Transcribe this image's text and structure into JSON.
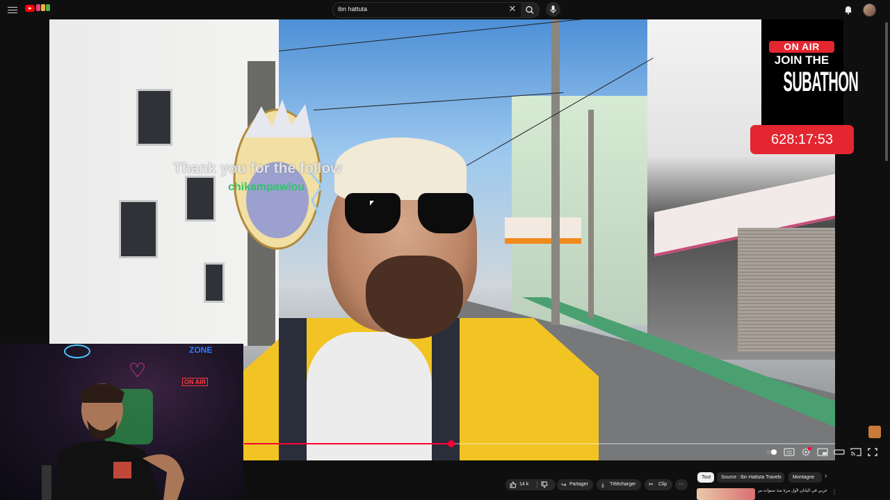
{
  "search": {
    "query": "ibn hattuta"
  },
  "overlay": {
    "follow_alert": {
      "line1": "Thank you for the follow",
      "line2": "chikampawlou"
    },
    "subathon": {
      "on_air": "ON AIR",
      "join": "JOIN THE",
      "word": "SUBATHON",
      "timer": "628:17:53"
    },
    "webcam": {
      "neon_zone": "ZONE",
      "neon_on_air": "ON AIR"
    }
  },
  "player": {
    "progress_fraction": 0.35
  },
  "actions": {
    "likes": "14 k",
    "share": "Partager",
    "download": "Télécharger",
    "clip": "Clip",
    "more": "⋯"
  },
  "chips": [
    {
      "label": "Tout",
      "selected": true
    },
    {
      "label": "Source : Ibn Hattuta Travels",
      "selected": false
    },
    {
      "label": "Montagne",
      "selected": false
    }
  ],
  "recommendation": {
    "title": "عربي في اليابان لأول مرة منذ سنوات من"
  },
  "colors": {
    "accent": "#ff0033",
    "live_red": "#e3262f",
    "bg": "#0f0f0f"
  },
  "icons": [
    "menu-icon",
    "youtube-logo",
    "clear-icon",
    "search-icon",
    "mic-icon",
    "bell-icon",
    "like-icon",
    "dislike-icon",
    "share-icon",
    "download-icon",
    "clip-icon",
    "settings-icon",
    "subtitles-icon",
    "miniplayer-icon",
    "theater-icon",
    "cast-icon",
    "fullscreen-icon",
    "autoplay-toggle"
  ]
}
